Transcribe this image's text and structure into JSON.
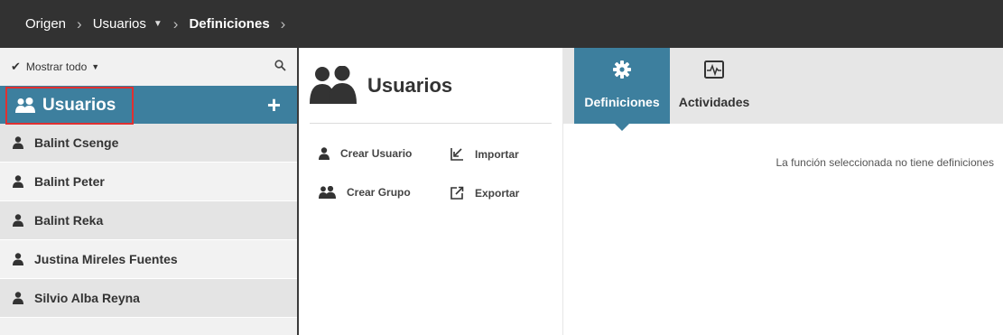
{
  "breadcrumb": {
    "items": [
      "Origen",
      "Usuarios",
      "Definiciones"
    ]
  },
  "sidebar": {
    "filter_label": "Mostrar todo",
    "title": "Usuarios",
    "users": [
      "Balint Csenge",
      "Balint Peter",
      "Balint Reka",
      "Justina Mireles Fuentes",
      "Silvio Alba Reyna"
    ]
  },
  "middle": {
    "title": "Usuarios",
    "actions": {
      "create_user": "Crear Usuario",
      "import": "Importar",
      "create_group": "Crear Grupo",
      "export": "Exportar"
    }
  },
  "right": {
    "tabs": [
      "Definiciones",
      "Actividades"
    ],
    "message": "La función seleccionada no tiene definiciones"
  },
  "colors": {
    "accent": "#3d7f9e",
    "topbar": "#323232",
    "highlight_border": "#e03030"
  },
  "icons": [
    "checkmark-icon",
    "search-icon",
    "users-icon",
    "plus-icon",
    "user-icon",
    "import-icon",
    "export-icon",
    "gear-icon",
    "activity-icon"
  ]
}
